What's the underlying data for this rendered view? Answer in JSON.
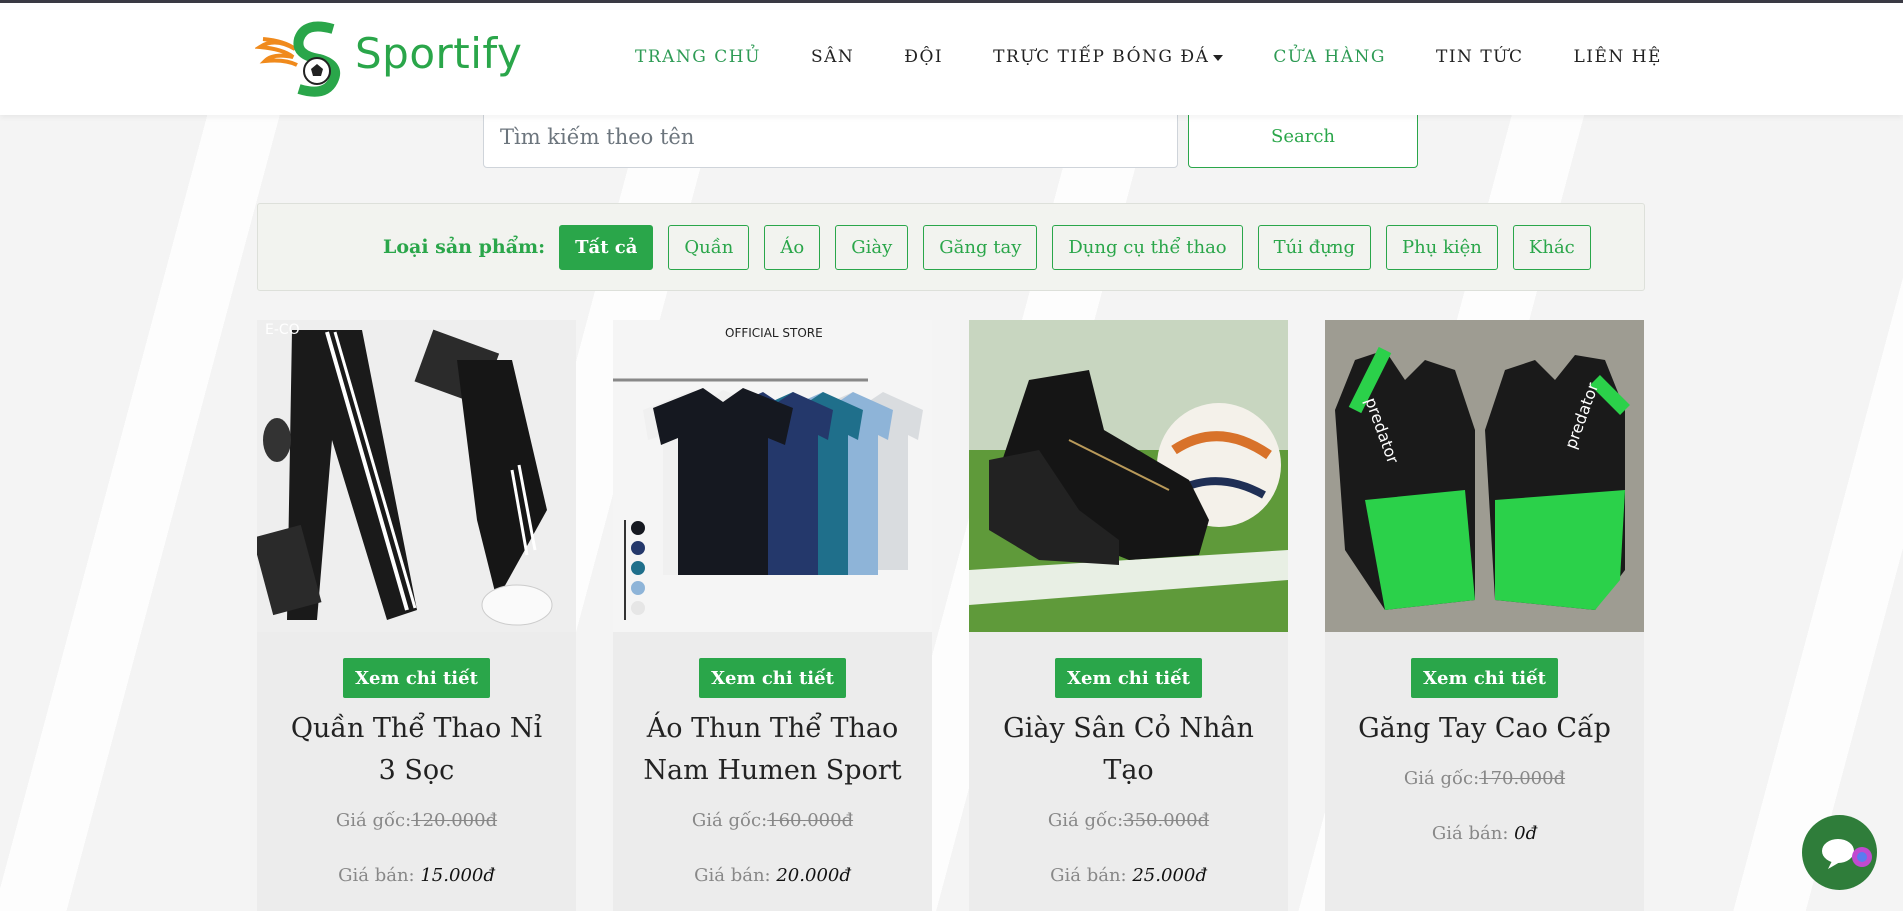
{
  "brand": {
    "name": "Sportify"
  },
  "nav": {
    "items": [
      {
        "label": "TRANG CHỦ",
        "active": true
      },
      {
        "label": "SÂN",
        "active": false
      },
      {
        "label": "ĐỘI",
        "active": false
      },
      {
        "label": "TRỰC TIẾP BÓNG ĐÁ",
        "active": false,
        "dropdown": true
      },
      {
        "label": "CỬA HÀNG",
        "active": true
      },
      {
        "label": "TIN TỨC",
        "active": false
      },
      {
        "label": "LIÊN HỆ",
        "active": false
      }
    ]
  },
  "search": {
    "placeholder": "Tìm kiếm theo tên",
    "button_label": "Search"
  },
  "filters": {
    "label": "Loại sản phẩm:",
    "chips": [
      {
        "label": "Tất cả",
        "active": true
      },
      {
        "label": "Quần",
        "active": false
      },
      {
        "label": "Áo",
        "active": false
      },
      {
        "label": "Giày",
        "active": false
      },
      {
        "label": "Găng tay",
        "active": false
      },
      {
        "label": "Dụng cụ thể thao",
        "active": false
      },
      {
        "label": "Túi đựng",
        "active": false
      },
      {
        "label": "Phụ kiện",
        "active": false
      },
      {
        "label": "Khác",
        "active": false
      }
    ]
  },
  "products": [
    {
      "button": "Xem chi tiết",
      "title": "Quần Thể Thao Nỉ 3 Sọc",
      "orig_label": "Giá gốc:",
      "orig_price": "120.000đ",
      "sale_label": "Giá bán:",
      "sale_price": "15.000đ",
      "image_icon": "pants-icon",
      "overlay_text": "E-CO"
    },
    {
      "button": "Xem chi tiết",
      "title": "Áo Thun Thể Thao Nam Humen Sport",
      "orig_label": "Giá gốc:",
      "orig_price": "160.000đ",
      "sale_label": "Giá bán:",
      "sale_price": "20.000đ",
      "image_icon": "tshirt-icon",
      "overlay_text": "OFFICIAL STORE"
    },
    {
      "button": "Xem chi tiết",
      "title": "Giày Sân Cỏ Nhân Tạo",
      "orig_label": "Giá gốc:",
      "orig_price": "350.000đ",
      "sale_label": "Giá bán:",
      "sale_price": "25.000đ",
      "image_icon": "football-boot-icon",
      "overlay_text": ""
    },
    {
      "button": "Xem chi tiết",
      "title": "Găng Tay Cao Cấp",
      "orig_label": "Giá gốc:",
      "orig_price": "170.000đ",
      "sale_label": "Giá bán:",
      "sale_price": "0đ",
      "image_icon": "goalkeeper-glove-icon",
      "overlay_text": "predator"
    }
  ],
  "colors": {
    "accent": "#2aa64a",
    "chat": "#2f7d3a"
  }
}
